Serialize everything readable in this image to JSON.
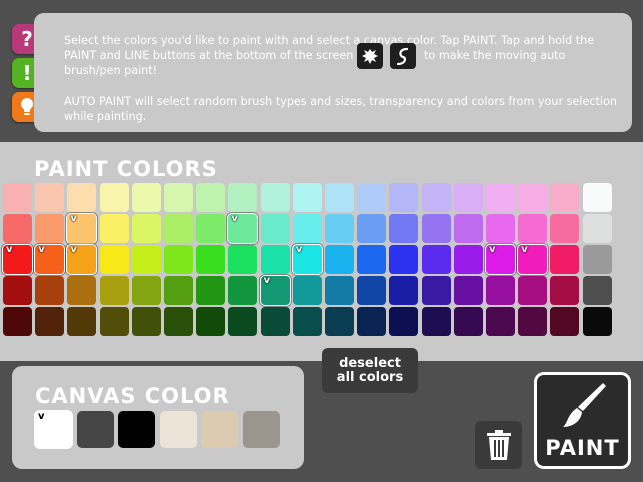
{
  "side_buttons": [
    {
      "name": "help",
      "label": "?",
      "color": "#b8397a"
    },
    {
      "name": "info",
      "label": "!",
      "color": "#55b323"
    },
    {
      "name": "tip",
      "label": "",
      "color": "#f07a1a"
    }
  ],
  "instructions": {
    "p1_a": "Select the colors you'd like to paint with and select a canvas color. Tap PAINT. Tap and hold the PAINT and LINE buttons at the bottom of the screen",
    "p1_b": "to make the moving auto brush/pen paint!",
    "p2": "AUTO PAINT will select random brush types and sizes, transparency and colors from your selection while painting."
  },
  "paint_colors": {
    "title": "PAINT COLORS",
    "check_mark": "v",
    "rows": [
      [
        {
          "c": "#f9b0b0"
        },
        {
          "c": "#fbc6ae"
        },
        {
          "c": "#fbddae"
        },
        {
          "c": "#f9f4ab"
        },
        {
          "c": "#ecf8ab"
        },
        {
          "c": "#d6f6ad"
        },
        {
          "c": "#bef3ae"
        },
        {
          "c": "#b2f1bf"
        },
        {
          "c": "#b0f2dc"
        },
        {
          "c": "#aff3f3"
        },
        {
          "c": "#aee2f6"
        },
        {
          "c": "#afcbf7"
        },
        {
          "c": "#b3b6f7"
        },
        {
          "c": "#c4b3f6"
        },
        {
          "c": "#daaff5"
        },
        {
          "c": "#f0aef3"
        },
        {
          "c": "#f7aee6"
        },
        {
          "c": "#f8aecb"
        },
        {
          "c": "#f9fafa"
        }
      ],
      [
        {
          "c": "#f86a6a"
        },
        {
          "c": "#fa9a6a"
        },
        {
          "c": "#fbc36b",
          "sel": true
        },
        {
          "c": "#fbef66"
        },
        {
          "c": "#dbf565"
        },
        {
          "c": "#aaef66"
        },
        {
          "c": "#7eea6a"
        },
        {
          "c": "#6ce99a",
          "sel": true
        },
        {
          "c": "#69eacb"
        },
        {
          "c": "#68ecec"
        },
        {
          "c": "#68cdf2"
        },
        {
          "c": "#6a9ef4"
        },
        {
          "c": "#7379f4"
        },
        {
          "c": "#9574f2"
        },
        {
          "c": "#be6bf0"
        },
        {
          "c": "#e76aee"
        },
        {
          "c": "#f56ad3"
        },
        {
          "c": "#f66ca0"
        },
        {
          "c": "#dedfdf"
        }
      ],
      [
        {
          "c": "#f21a1a",
          "sel": true
        },
        {
          "c": "#f5601a",
          "sel": true
        },
        {
          "c": "#f7a21b",
          "sel": true
        },
        {
          "c": "#f7e81a"
        },
        {
          "c": "#c4ef1b"
        },
        {
          "c": "#7ee71b"
        },
        {
          "c": "#3bde1f"
        },
        {
          "c": "#1bdf5e"
        },
        {
          "c": "#1be0a8"
        },
        {
          "c": "#1be4e4",
          "sel": true
        },
        {
          "c": "#1bb3ee"
        },
        {
          "c": "#1c69f0"
        },
        {
          "c": "#2c32f0"
        },
        {
          "c": "#5b2cee"
        },
        {
          "c": "#9a1ceb"
        },
        {
          "c": "#dc1be8",
          "sel": true
        },
        {
          "c": "#f01cbc",
          "sel": true
        },
        {
          "c": "#f01c66"
        },
        {
          "c": "#9a9a9a"
        }
      ],
      [
        {
          "c": "#a30e0e"
        },
        {
          "c": "#a8400e"
        },
        {
          "c": "#ab6f10"
        },
        {
          "c": "#a9a00f"
        },
        {
          "c": "#84a512"
        },
        {
          "c": "#539e11"
        },
        {
          "c": "#229612"
        },
        {
          "c": "#11963e"
        },
        {
          "c": "#129872",
          "sel": true
        },
        {
          "c": "#129a9a"
        },
        {
          "c": "#117aa5"
        },
        {
          "c": "#1146a6"
        },
        {
          "c": "#1a1ea6"
        },
        {
          "c": "#3b1aa3"
        },
        {
          "c": "#6810a1"
        },
        {
          "c": "#960f9e"
        },
        {
          "c": "#a50f81"
        },
        {
          "c": "#a50e44"
        },
        {
          "c": "#4e4e4e"
        }
      ],
      [
        {
          "c": "#4f0808"
        },
        {
          "c": "#512208"
        },
        {
          "c": "#533808"
        },
        {
          "c": "#524d08"
        },
        {
          "c": "#41510a"
        },
        {
          "c": "#2a4f09"
        },
        {
          "c": "#124a0a"
        },
        {
          "c": "#094a1f"
        },
        {
          "c": "#0a4b38"
        },
        {
          "c": "#0a4d4d"
        },
        {
          "c": "#0a3d52"
        },
        {
          "c": "#092353"
        },
        {
          "c": "#0d0f53"
        },
        {
          "c": "#1e0d51"
        },
        {
          "c": "#340950"
        },
        {
          "c": "#4b084f"
        },
        {
          "c": "#520840"
        },
        {
          "c": "#520822"
        },
        {
          "c": "#0a0a0a"
        }
      ]
    ]
  },
  "deselect": {
    "line1": "deselect",
    "line2": "all colors"
  },
  "canvas_color": {
    "title": "CANVAS COLOR",
    "check_mark": "v",
    "swatches": [
      {
        "c": "#ffffff",
        "sel": true
      },
      {
        "c": "#454545"
      },
      {
        "c": "#000000"
      },
      {
        "c": "#ece4d6"
      },
      {
        "c": "#dccbb0"
      },
      {
        "c": "#9a968d"
      }
    ]
  },
  "paint_button": {
    "label": "PAINT"
  }
}
